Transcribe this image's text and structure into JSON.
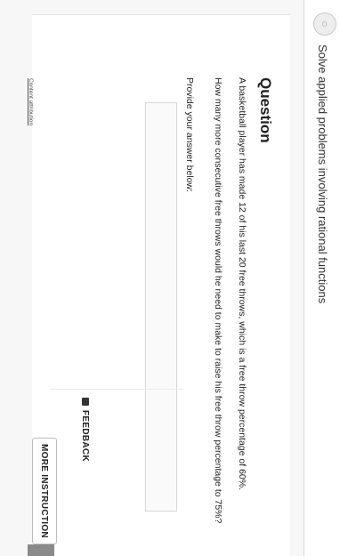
{
  "header": {
    "title": "Solve applied problems involving rational functions",
    "icon": "lesson-icon"
  },
  "question": {
    "heading": "Question",
    "line1": "A basketball player has made 12 of his last 20 free throws, which is a free throw percentage of 60%.",
    "line2": "How many more consecutive free throws would he need to make to raise his free throw percentage to 75%?"
  },
  "answer": {
    "label": "Provide your answer below:",
    "value": "",
    "placeholder": ""
  },
  "buttons": {
    "feedback": "FEEDBACK",
    "more_instruction": "MORE INSTRUCTION"
  },
  "footer": {
    "attribution": "Content attribution"
  }
}
